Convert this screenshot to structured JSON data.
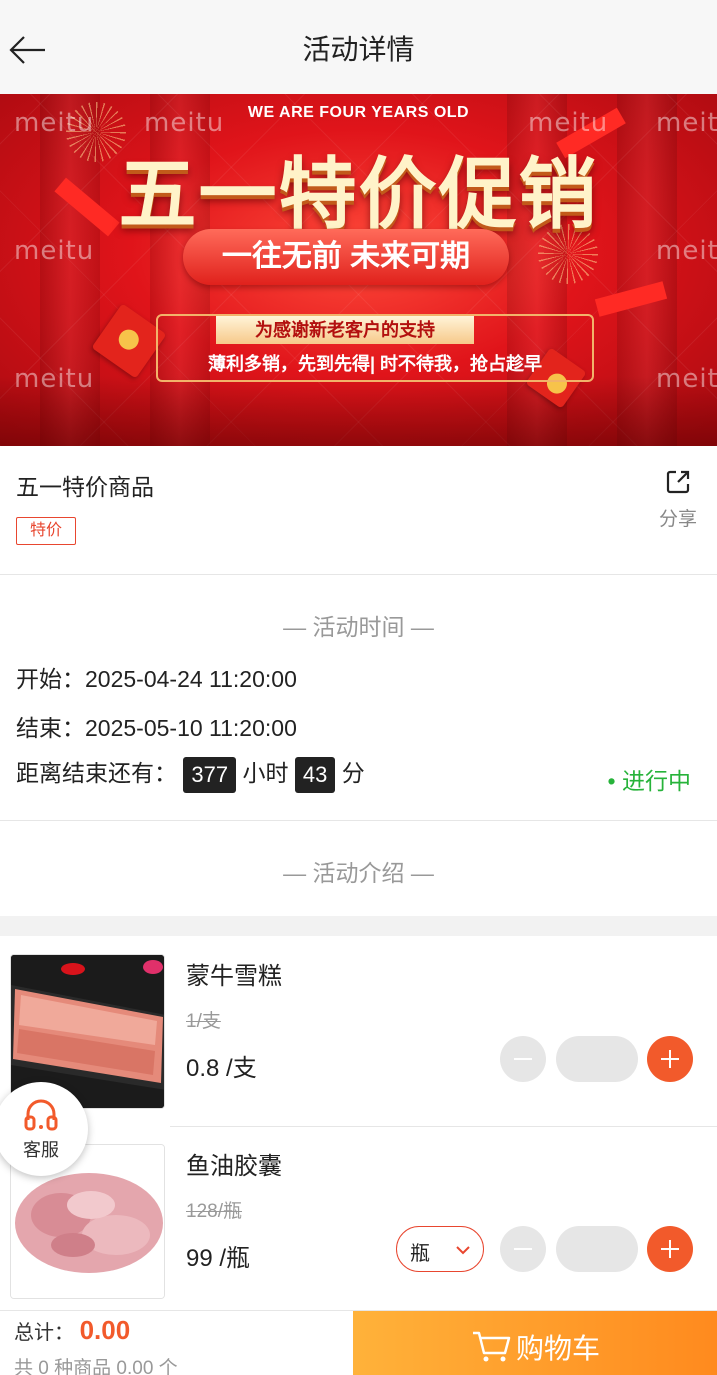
{
  "header": {
    "title": "活动详情"
  },
  "banner": {
    "eyebrow": "WE ARE FOUR YEARS OLD",
    "headline": "五一特价促销",
    "pill": "一往无前 未来可期",
    "tag": "为感谢新老客户的支持",
    "slogan": "薄利多销，先到先得|    时不待我，抢占趁早",
    "watermark": "meitu"
  },
  "activity": {
    "name": "五一特价商品",
    "tag": "特价",
    "share_label": "分享"
  },
  "time_section": {
    "title": "—  活动时间  —",
    "start_label": "开始：",
    "start": "2025-04-24 11:20:00",
    "end_label": "结束：",
    "end": "2025-05-10 11:20:00",
    "remaining_label": "距离结束还有：",
    "hours": "377",
    "hours_unit": "小时",
    "minutes": "43",
    "minutes_unit": "分",
    "status": "• 进行中"
  },
  "intro_section": {
    "title": "—  活动介绍  —"
  },
  "products": [
    {
      "name": "蒙牛雪糕",
      "old_price": "1/支",
      "price": "0.8 /支"
    },
    {
      "name": "鱼油胶囊",
      "old_price": "128/瓶",
      "price": "99 /瓶",
      "unit": "瓶"
    }
  ],
  "customer_service": {
    "label": "客服"
  },
  "bottom": {
    "total_label": "总计：",
    "total_amount": "0.00",
    "summary": "共 0 种商品 0.00 个",
    "cart_label": "购物车"
  },
  "colors": {
    "accent": "#f25a2b",
    "cart_gradient_start": "#ffb23a",
    "cart_gradient_end": "#ff8a1e",
    "status_green": "#27b33a",
    "banner_red": "#e0141a"
  }
}
